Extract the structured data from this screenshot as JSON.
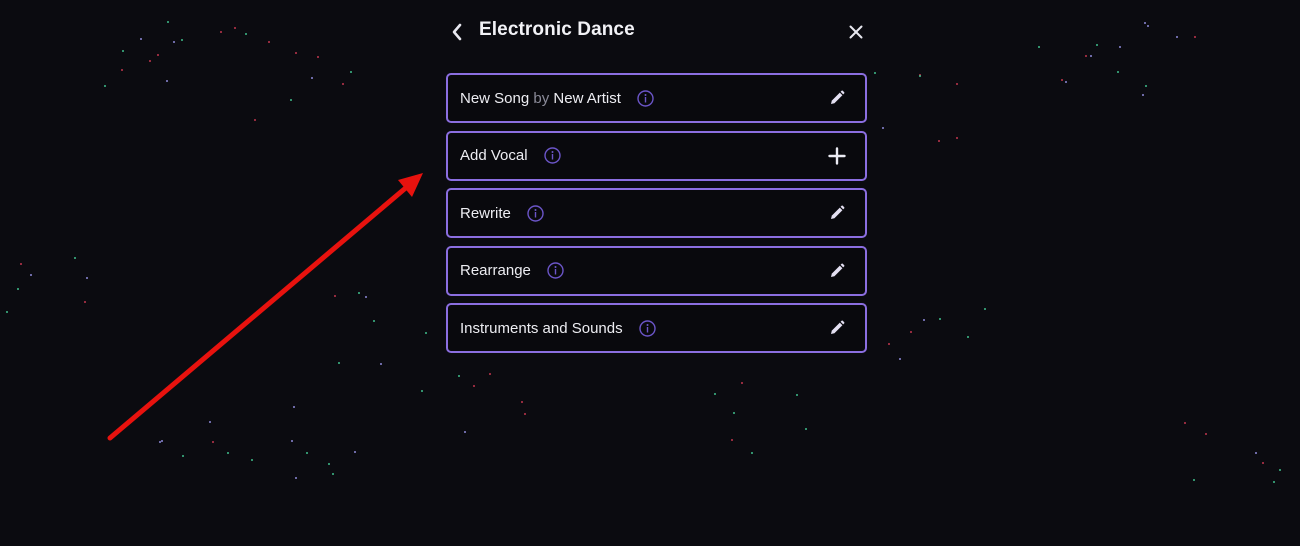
{
  "header": {
    "title": "Electronic Dance",
    "back_icon": "chevron-left-icon",
    "close_icon": "close-icon"
  },
  "cards": [
    {
      "id": "song",
      "label_parts": [
        "New Song",
        " by ",
        "New Artist"
      ],
      "info_icon": "info-icon",
      "action_icon": "pencil-icon"
    },
    {
      "id": "add-vocal",
      "label": "Add Vocal",
      "info_icon": "info-icon",
      "action_icon": "plus-icon"
    },
    {
      "id": "rewrite",
      "label": "Rewrite",
      "info_icon": "info-icon",
      "action_icon": "pencil-icon"
    },
    {
      "id": "rearrange",
      "label": "Rearrange",
      "info_icon": "info-icon",
      "action_icon": "pencil-icon"
    },
    {
      "id": "instruments",
      "label": "Instruments and Sounds",
      "info_icon": "info-icon",
      "action_icon": "pencil-icon"
    }
  ],
  "annotation": {
    "type": "arrow",
    "color": "#e8120e",
    "points_to": "add-vocal"
  },
  "colors": {
    "background": "#0b0b10",
    "card_border": "#8b6ee0",
    "info_icon": "#6b55c8",
    "text": "#ededf2",
    "muted_text": "#8a8a98",
    "speck_colors": [
      "#c0364e",
      "#3fbf8c",
      "#8d8ad8"
    ]
  }
}
